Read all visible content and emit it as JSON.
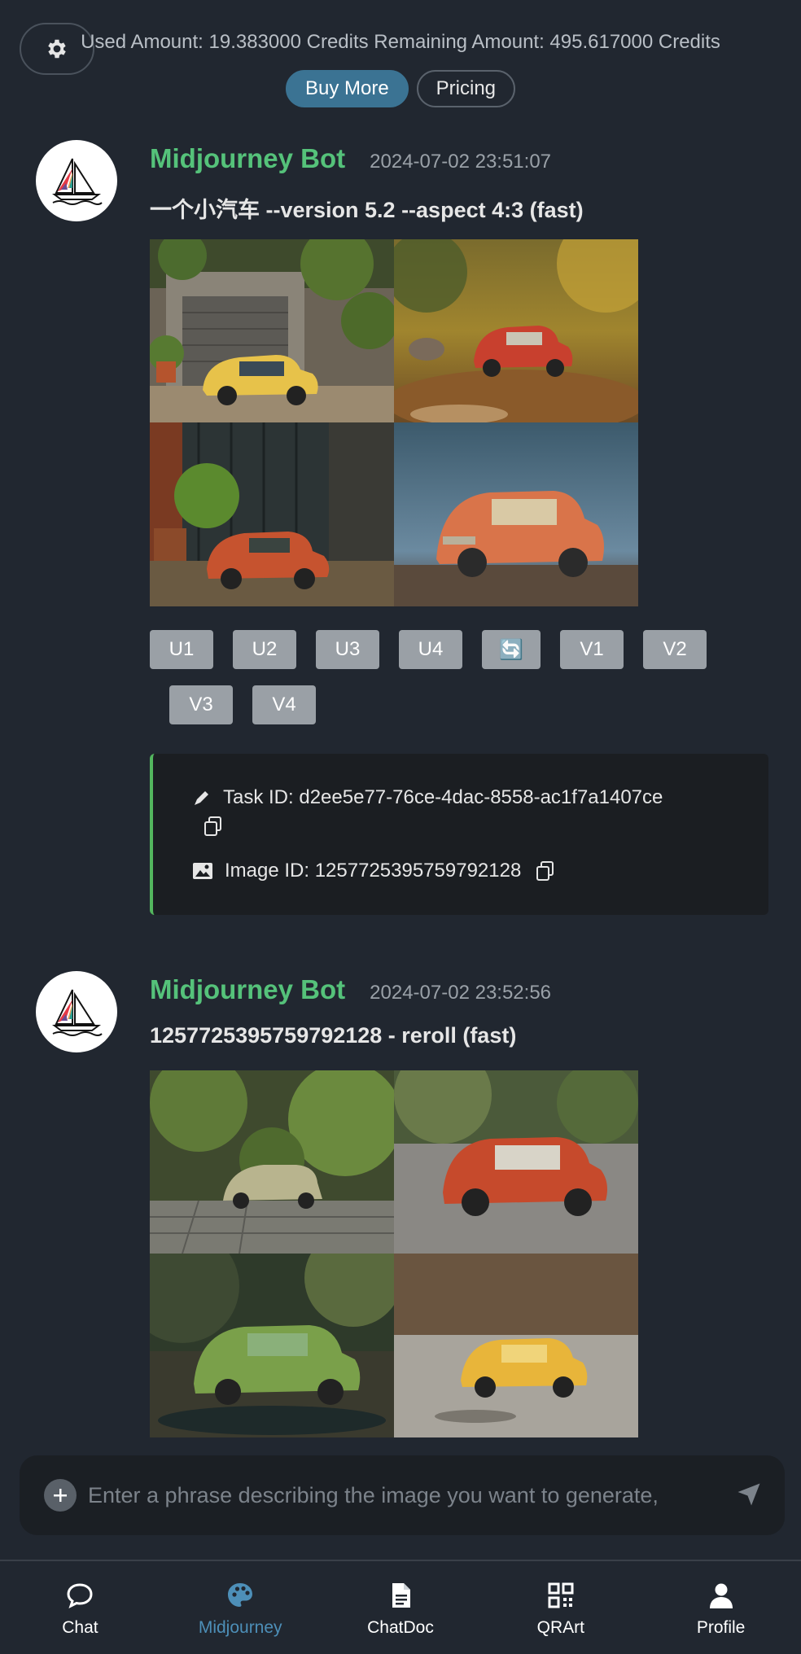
{
  "header": {
    "credits_text": "Used Amount: 19.383000 Credits Remaining Amount: 495.617000 Credits",
    "buy_more_label": "Buy More",
    "pricing_label": "Pricing"
  },
  "messages": [
    {
      "bot_name": "Midjourney Bot",
      "timestamp": "2024-07-02 23:51:07",
      "prompt": "一个小汽车 --version 5.2 --aspect 4:3 (fast)",
      "images": [
        "yellow-car-house",
        "red-car-autumn",
        "orange-car-garden",
        "orange-car-blue-backdrop"
      ],
      "actions_row1": [
        "U1",
        "U2",
        "U3",
        "U4",
        "🔄",
        "V1",
        "V2"
      ],
      "actions_row2": [
        "V3",
        "V4"
      ],
      "task_id": "Task ID: d2ee5e77-76ce-4dac-8558-ac1f7a1407ce",
      "image_id": "Image ID: 1257725395759792128"
    },
    {
      "bot_name": "Midjourney Bot",
      "timestamp": "2024-07-02 23:52:56",
      "prompt": "1257725395759792128 - reroll (fast)",
      "images": [
        "white-beetle-plants",
        "red-car-street",
        "green-car-forest",
        "yellow-car-stones"
      ]
    }
  ],
  "composer": {
    "placeholder": "Enter a phrase describing the image you want to generate,"
  },
  "nav": {
    "items": [
      {
        "label": "Chat",
        "icon": "chat-bubble-icon"
      },
      {
        "label": "Midjourney",
        "icon": "palette-icon",
        "active": true
      },
      {
        "label": "ChatDoc",
        "icon": "document-icon"
      },
      {
        "label": "QRArt",
        "icon": "qr-code-icon"
      },
      {
        "label": "Profile",
        "icon": "person-icon"
      }
    ]
  },
  "colors": {
    "background": "#212730",
    "accent_green": "#55c27a",
    "accent_blue": "#3b7393",
    "nav_active": "#4d8fb8"
  }
}
